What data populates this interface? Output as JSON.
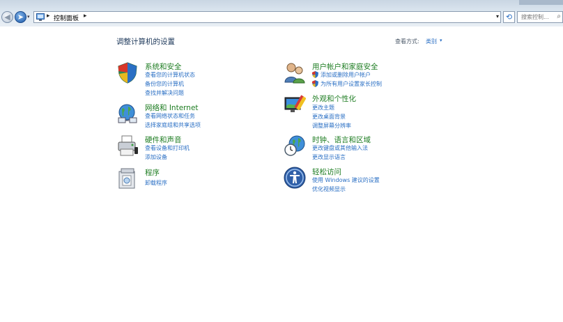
{
  "addressbar": {
    "breadcrumb": "控制面板",
    "separator": "▸",
    "dropdown": "▾",
    "history_arrow": "▾",
    "refresh_icon": "⟲",
    "search_placeholder": "搜索控制...",
    "search_icon": "⌕"
  },
  "header": {
    "title": "调整计算机的设置",
    "view_by_label": "查看方式:",
    "view_by_value": "类别",
    "view_by_arrow": "▾"
  },
  "categories": {
    "system": {
      "title": "系统和安全",
      "links": [
        "查看您的计算机状态",
        "备份您的计算机",
        "查找并解决问题"
      ]
    },
    "network": {
      "title": "网络和 Internet",
      "links": [
        "查看网络状态和任务",
        "选择家庭组和共享选项"
      ]
    },
    "hardware": {
      "title": "硬件和声音",
      "links": [
        "查看设备和打印机",
        "添加设备"
      ]
    },
    "programs": {
      "title": "程序",
      "links": [
        "卸载程序"
      ]
    },
    "users": {
      "title": "用户帐户和家庭安全",
      "links": [
        "添加或删除用户帐户",
        "为所有用户设置家长控制"
      ]
    },
    "appearance": {
      "title": "外观和个性化",
      "links": [
        "更改主题",
        "更改桌面背景",
        "调整屏幕分辨率"
      ]
    },
    "clock": {
      "title": "时钟、语言和区域",
      "links": [
        "更改键盘或其他输入法",
        "更改显示语言"
      ]
    },
    "access": {
      "title": "轻松访问",
      "links": [
        "使用 Windows 建议的设置",
        "优化视频显示"
      ]
    }
  },
  "colors": {
    "category_title": "#1e7d22",
    "link": "#2a6fc4",
    "heading": "#1e395b"
  }
}
